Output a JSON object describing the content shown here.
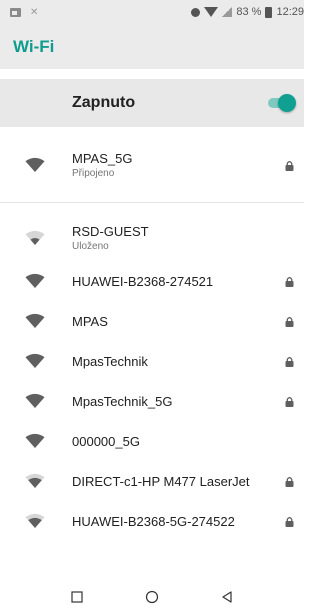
{
  "status_bar": {
    "battery_text": "83 %",
    "time": "12:29"
  },
  "header": {
    "title": "Wi-Fi"
  },
  "master_switch": {
    "label": "Zapnuto",
    "on": true
  },
  "connected_network": {
    "name": "MPAS_5G",
    "status": "Připojeno",
    "secured": true,
    "signal": "strong"
  },
  "networks": [
    {
      "name": "RSD-GUEST",
      "status": "Uloženo",
      "secured": false,
      "signal": "weak"
    },
    {
      "name": "HUAWEI-B2368-274521",
      "status": "",
      "secured": true,
      "signal": "strong"
    },
    {
      "name": "MPAS",
      "status": "",
      "secured": true,
      "signal": "strong"
    },
    {
      "name": "MpasTechnik",
      "status": "",
      "secured": true,
      "signal": "strong"
    },
    {
      "name": "MpasTechnik_5G",
      "status": "",
      "secured": true,
      "signal": "strong"
    },
    {
      "name": "000000_5G",
      "status": "",
      "secured": false,
      "signal": "strong"
    },
    {
      "name": "DIRECT-c1-HP M477 LaserJet",
      "status": "",
      "secured": true,
      "signal": "medium"
    },
    {
      "name": "HUAWEI-B2368-5G-274522",
      "status": "",
      "secured": true,
      "signal": "medium"
    }
  ],
  "colors": {
    "accent": "#0f9d8f",
    "header_bg": "#ebebeb"
  },
  "nav_icons": [
    "recents-square-icon",
    "home-circle-icon",
    "back-triangle-icon"
  ]
}
